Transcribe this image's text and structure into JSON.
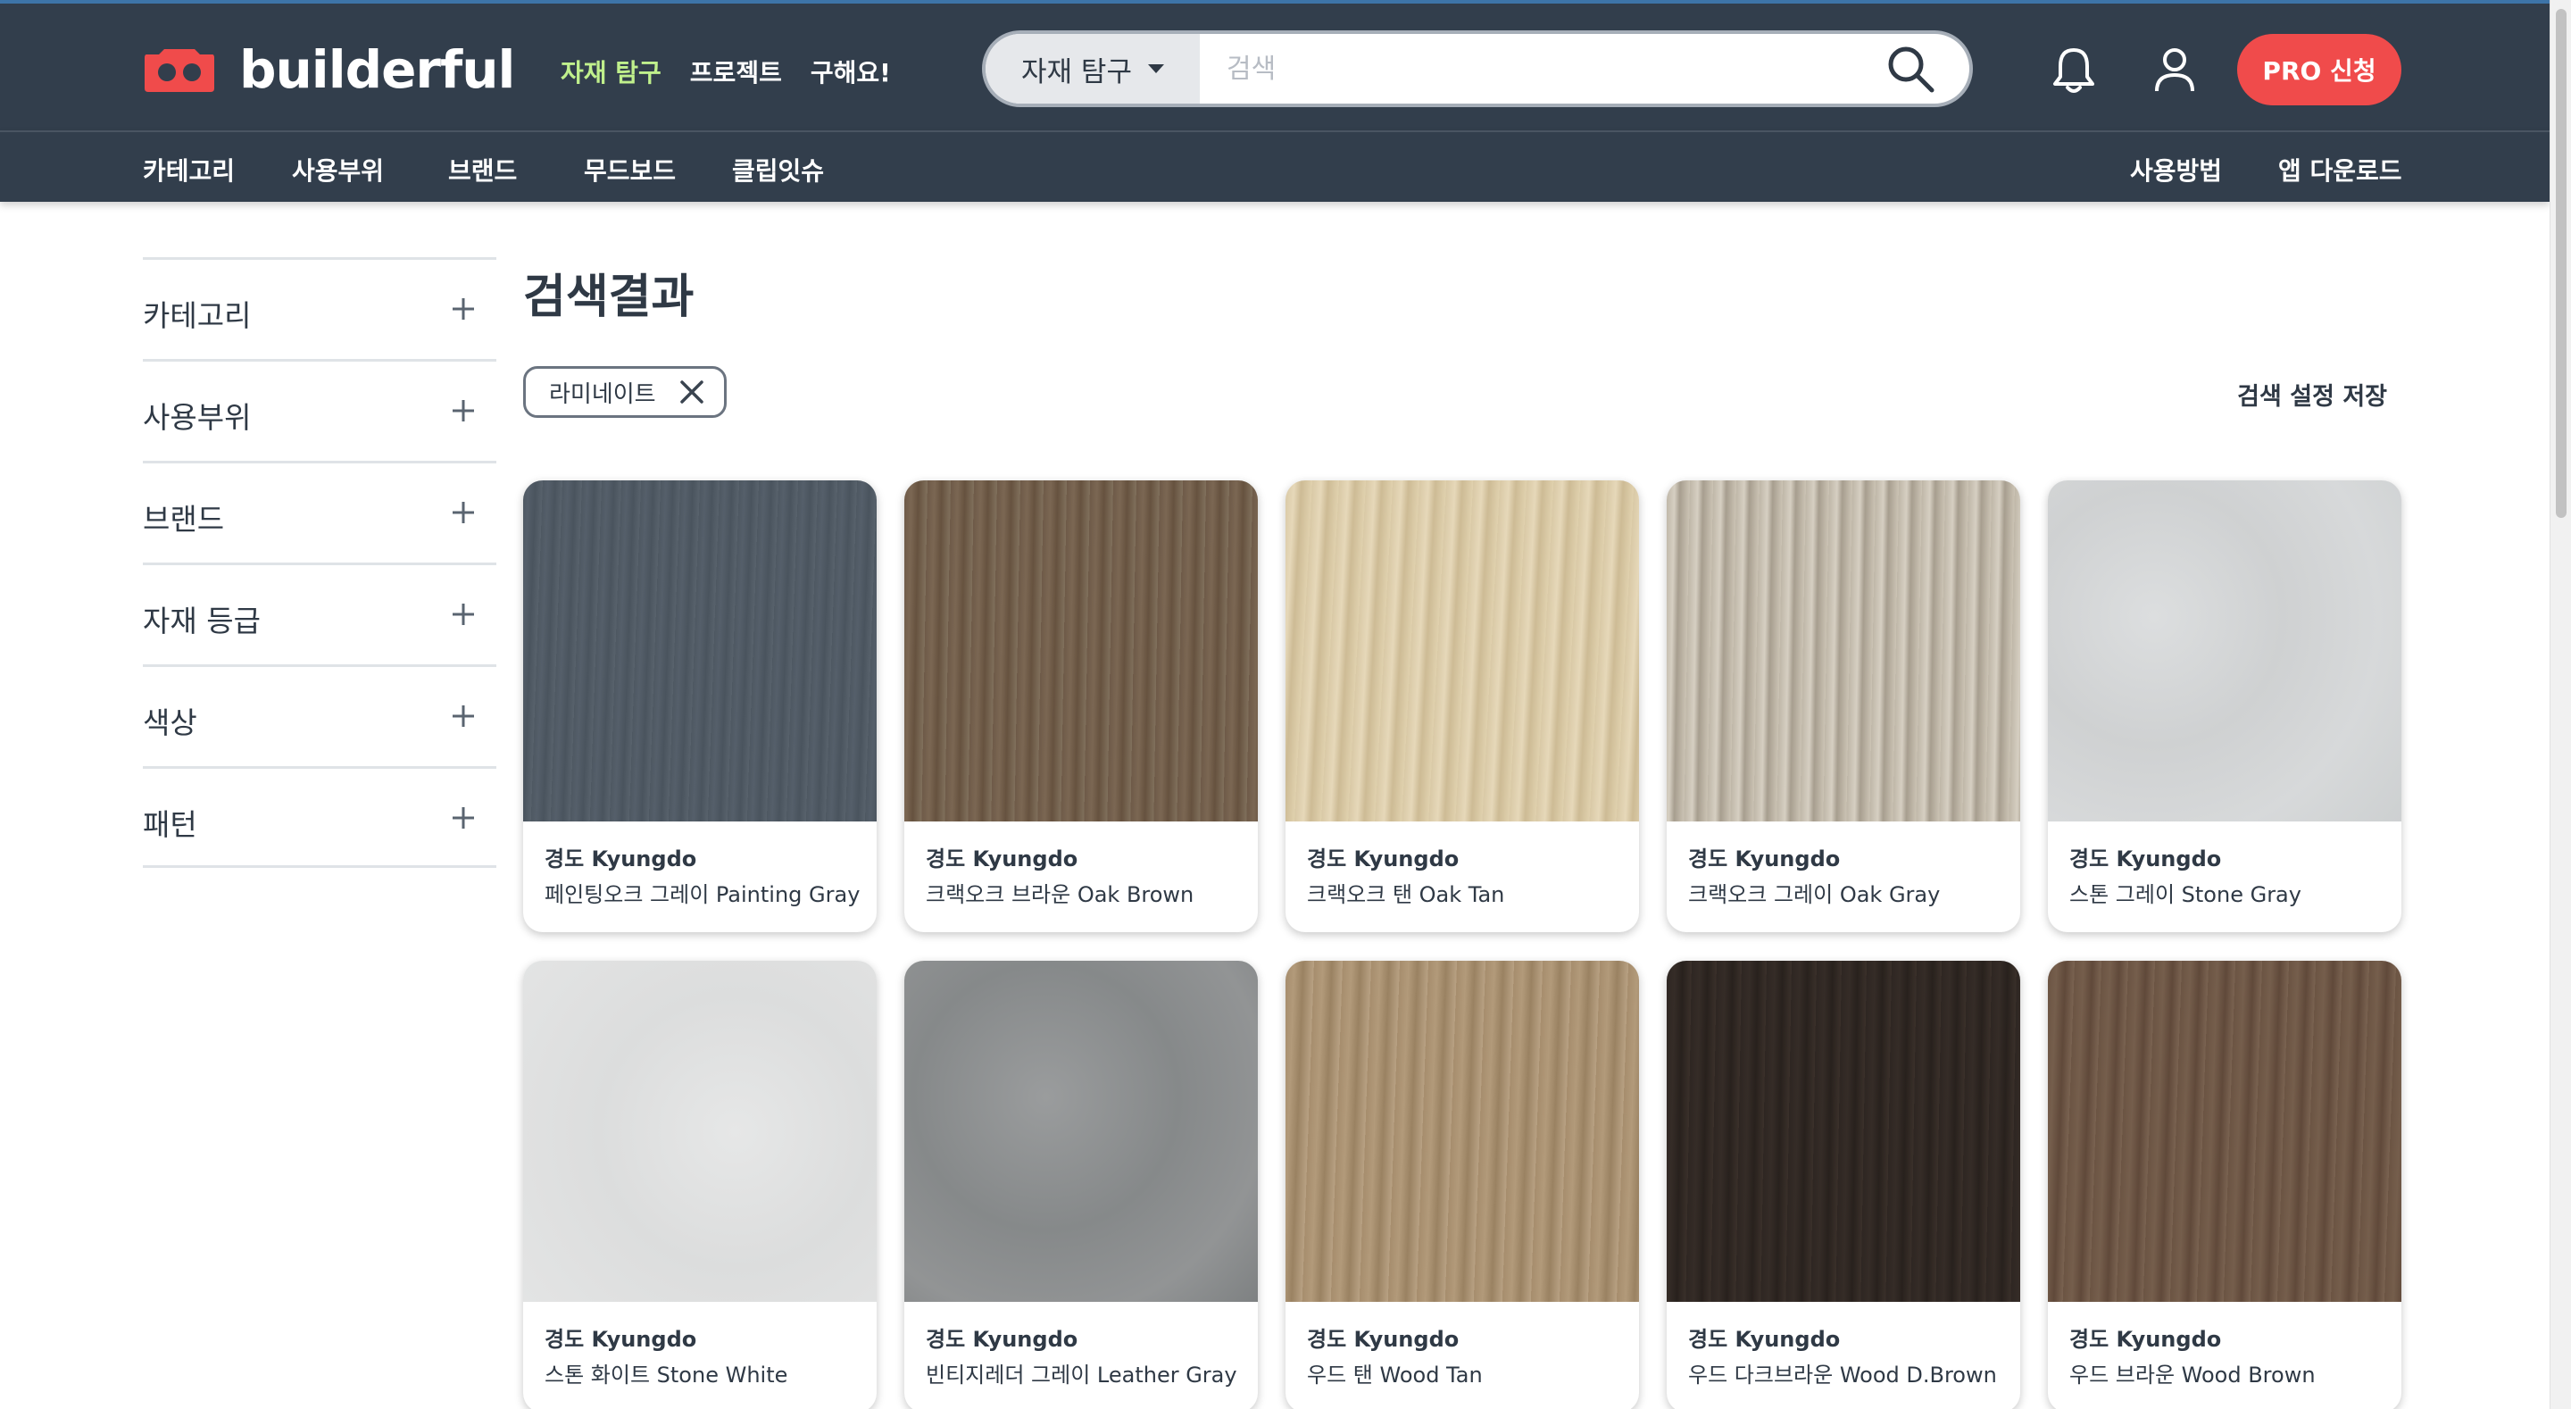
{
  "header": {
    "logo_text": "builderful",
    "nav": [
      "자재 탐구",
      "프로젝트",
      "구해요!"
    ],
    "search": {
      "category": "자재 탐구",
      "placeholder": "검색"
    },
    "pro_button": "PRO 신청"
  },
  "subnav": {
    "left": [
      "카테고리",
      "사용부위",
      "브랜드",
      "무드보드",
      "클립잇슈"
    ],
    "right": [
      "사용방법",
      "앱 다운로드"
    ]
  },
  "sidebar": {
    "filters": [
      "카테고리",
      "사용부위",
      "브랜드",
      "자재 등급",
      "색상",
      "패턴"
    ]
  },
  "main": {
    "title": "검색결과",
    "active_filter": "라미네이트",
    "save_search": "검색 설정 저장"
  },
  "products": [
    {
      "brand": "경도 Kyungdo",
      "name": "페인팅오크 그레이 Painting Gray"
    },
    {
      "brand": "경도 Kyungdo",
      "name": "크랙오크 브라운 Oak Brown"
    },
    {
      "brand": "경도 Kyungdo",
      "name": "크랙오크 탠 Oak Tan"
    },
    {
      "brand": "경도 Kyungdo",
      "name": "크랙오크 그레이 Oak Gray"
    },
    {
      "brand": "경도 Kyungdo",
      "name": "스톤 그레이 Stone Gray"
    },
    {
      "brand": "경도 Kyungdo",
      "name": "스톤 화이트 Stone White"
    },
    {
      "brand": "경도 Kyungdo",
      "name": "빈티지레더 그레이 Leather Gray"
    },
    {
      "brand": "경도 Kyungdo",
      "name": "우드 탠 Wood Tan"
    },
    {
      "brand": "경도 Kyungdo",
      "name": "우드 다크브라운 Wood D.Brown"
    },
    {
      "brand": "경도 Kyungdo",
      "name": "우드 브라운 Wood Brown"
    }
  ],
  "colors": {
    "header_bg": "#323e4c",
    "active_nav": "#c0f08c",
    "pro_button": "#f04b4b",
    "logo_red": "#f04b4b"
  },
  "icons": [
    "logo-mark-icon",
    "search-icon",
    "bell-icon",
    "user-icon",
    "plus-icon",
    "close-icon"
  ]
}
